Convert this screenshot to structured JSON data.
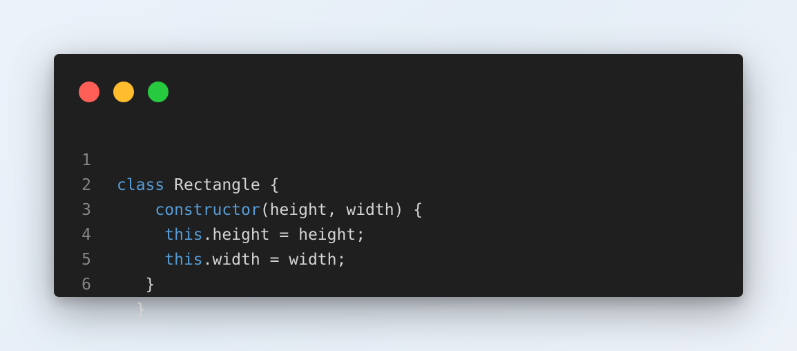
{
  "colors": {
    "dot_close": "#ff5f56",
    "dot_minimize": "#ffbd2e",
    "dot_maximize": "#27c93f",
    "keyword": "#569cd6",
    "text": "#d4d4d4",
    "line_number": "#858585",
    "editor_bg": "#1f1f1f"
  },
  "window_controls": {
    "close_icon": "red-circle",
    "minimize_icon": "yellow-circle",
    "maximize_icon": "green-circle"
  },
  "code": {
    "lines": [
      {
        "number": "1",
        "indent": "",
        "keyword": "class",
        "text": " Rectangle {"
      },
      {
        "number": "2",
        "indent": "    ",
        "keyword": "constructor",
        "text": "(height, width) {"
      },
      {
        "number": "3",
        "indent": "     ",
        "keyword": "this",
        "text": ".height = height;"
      },
      {
        "number": "4",
        "indent": "     ",
        "keyword": "this",
        "text": ".width = width;"
      },
      {
        "number": "5",
        "indent": "   ",
        "keyword": "",
        "text": "}"
      },
      {
        "number": "6",
        "indent": "  ",
        "keyword": "",
        "text": "}"
      }
    ]
  }
}
